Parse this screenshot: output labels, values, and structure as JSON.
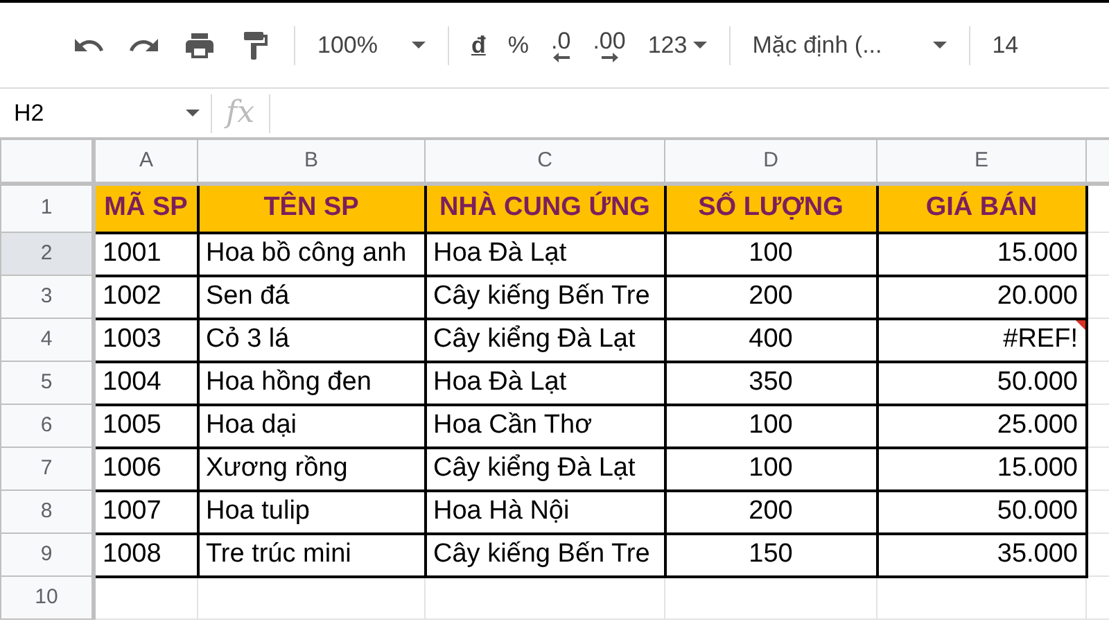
{
  "toolbar": {
    "zoom": "100%",
    "currency": "đ",
    "percent": "%",
    "decrease_decimals": ".0",
    "increase_decimals": ".00",
    "number_format": "123",
    "font": "Mặc định (...",
    "font_size": "14"
  },
  "formula_bar": {
    "name_box": "H2",
    "fx": "fx"
  },
  "columns": [
    {
      "letter": "A"
    },
    {
      "letter": "B"
    },
    {
      "letter": "C"
    },
    {
      "letter": "D"
    },
    {
      "letter": "E"
    }
  ],
  "header_row": {
    "number": "1",
    "cells": [
      "MÃ SP",
      "TÊN SP",
      "NHÀ CUNG ỨNG",
      "SỐ LƯỢNG",
      "GIÁ BÁN"
    ]
  },
  "rows": [
    {
      "number": "2",
      "selected": true,
      "has_error": false,
      "cells": [
        "1001",
        "Hoa bồ công anh",
        "Hoa Đà Lạt",
        "100",
        "15.000"
      ]
    },
    {
      "number": "3",
      "selected": false,
      "has_error": false,
      "cells": [
        "1002",
        "Sen đá",
        "Cây kiếng Bến Tre",
        "200",
        "20.000"
      ]
    },
    {
      "number": "4",
      "selected": false,
      "has_error": true,
      "cells": [
        "1003",
        "Cỏ 3 lá",
        "Cây kiểng Đà Lạt",
        "400",
        "#REF!"
      ]
    },
    {
      "number": "5",
      "selected": false,
      "has_error": false,
      "cells": [
        "1004",
        "Hoa hồng đen",
        "Hoa Đà Lạt",
        "350",
        "50.000"
      ]
    },
    {
      "number": "6",
      "selected": false,
      "has_error": false,
      "cells": [
        "1005",
        "Hoa dại",
        "Hoa Cần Thơ",
        "100",
        "25.000"
      ]
    },
    {
      "number": "7",
      "selected": false,
      "has_error": false,
      "cells": [
        "1006",
        "Xương rồng",
        "Cây kiểng Đà Lạt",
        "100",
        "15.000"
      ]
    },
    {
      "number": "8",
      "selected": false,
      "has_error": false,
      "cells": [
        "1007",
        "Hoa tulip",
        "Hoa Hà Nội",
        "200",
        "50.000"
      ]
    },
    {
      "number": "9",
      "selected": false,
      "has_error": false,
      "cells": [
        "1008",
        "Tre trúc mini",
        "Cây kiếng Bến Tre",
        "150",
        "35.000"
      ]
    }
  ],
  "empty_rows": [
    "10"
  ]
}
